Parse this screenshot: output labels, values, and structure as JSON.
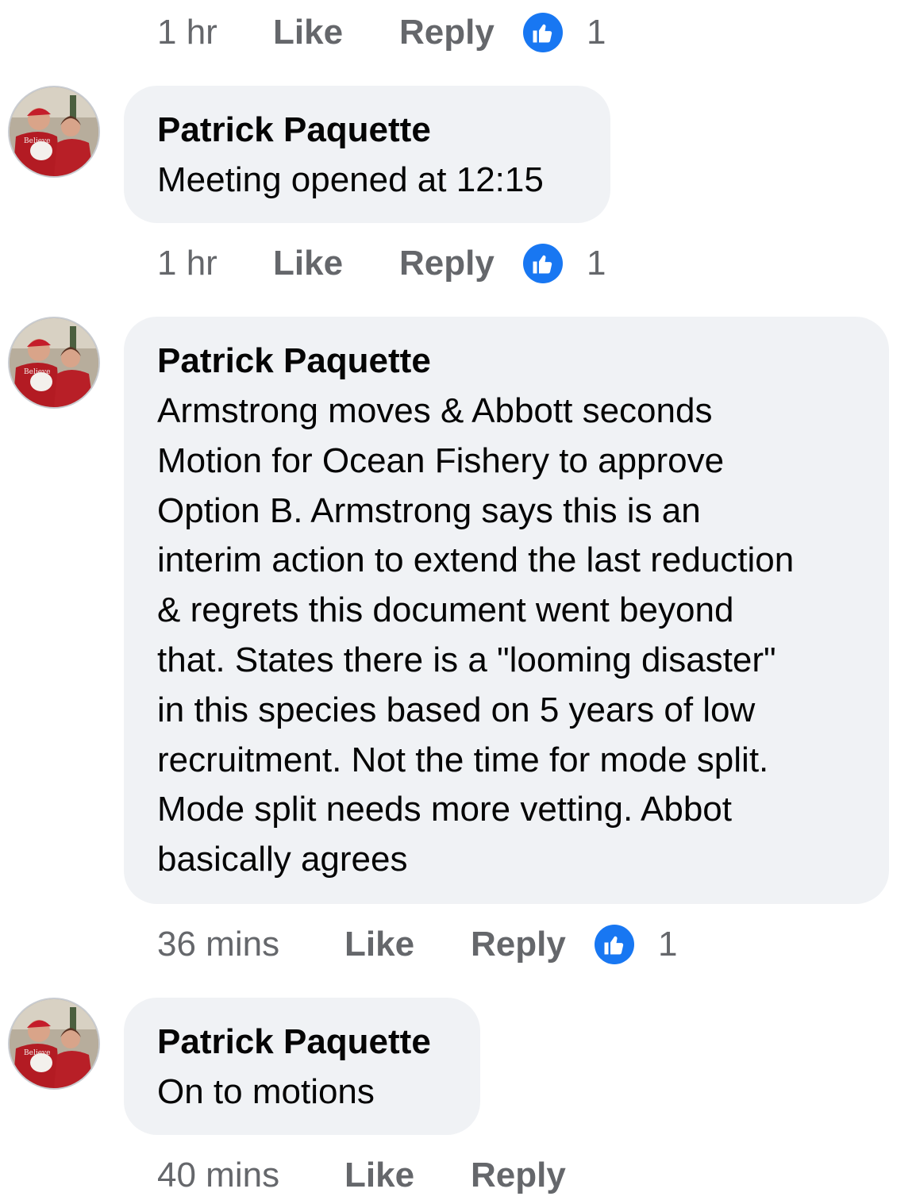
{
  "thread": {
    "top_actions": {
      "time": "1 hr",
      "like_label": "Like",
      "reply_label": "Reply",
      "reaction_count": "1"
    },
    "comments": [
      {
        "author": "Patrick Paquette",
        "text": "Meeting opened at 12:15",
        "time": "1 hr",
        "like_label": "Like",
        "reply_label": "Reply",
        "reaction_count": "1"
      },
      {
        "author": "Patrick Paquette",
        "text": "Armstrong moves & Abbott seconds\nMotion for Ocean Fishery to approve\nOption B. Armstrong says this is an\ninterim action to extend the last reduction\n& regrets this document went beyond\nthat. States there is a \"looming disaster\"\nin this species based on 5 years of low\nrecruitment. Not the time for mode split.\nMode split needs more vetting. Abbot\nbasically agrees",
        "time": "36 mins",
        "like_label": "Like",
        "reply_label": "Reply",
        "reaction_count": "1"
      },
      {
        "author": "Patrick Paquette",
        "text": "On to motions",
        "time": "40 mins",
        "like_label": "Like",
        "reply_label": "Reply"
      }
    ]
  },
  "colors": {
    "bubble_bg": "#f0f2f5",
    "meta_text": "#65676b",
    "like_blue": "#1877f2"
  },
  "icons": {
    "reaction": "thumbs-up-icon",
    "avatar": "profile-photo"
  }
}
